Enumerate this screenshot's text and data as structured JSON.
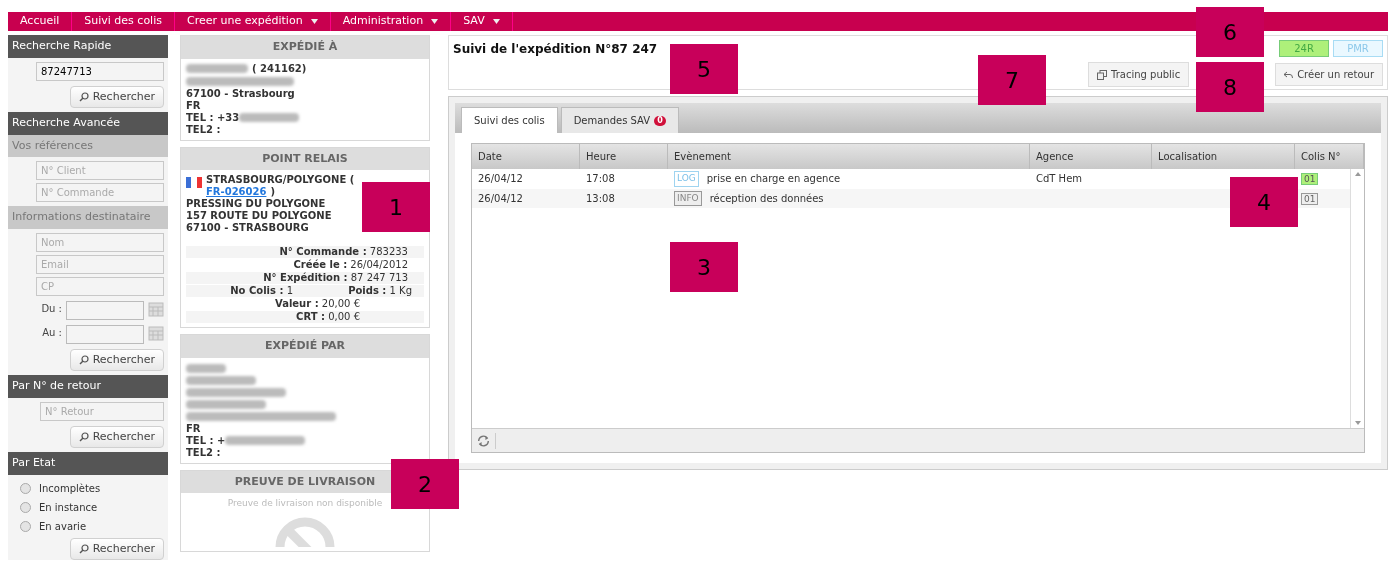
{
  "menu": [
    {
      "label": "Accueil",
      "dropdown": false
    },
    {
      "label": "Suivi des colis",
      "dropdown": false
    },
    {
      "label": "Creer une expédition",
      "dropdown": true
    },
    {
      "label": "Administration",
      "dropdown": true
    },
    {
      "label": "SAV",
      "dropdown": true
    }
  ],
  "sidebar": {
    "quick": {
      "title": "Recherche Rapide",
      "value": "87247713",
      "button": "Rechercher"
    },
    "advanced": {
      "title": "Recherche Avancée",
      "refs_title": "Vos références",
      "ref_fields": [
        {
          "placeholder": "N° Client"
        },
        {
          "placeholder": "N° Commande"
        }
      ],
      "dest_title": "Informations destinataire",
      "dest_fields": [
        {
          "placeholder": "Nom"
        },
        {
          "placeholder": "Email"
        },
        {
          "placeholder": "CP"
        }
      ],
      "from_label": "Du :",
      "to_label": "Au :",
      "button": "Rechercher"
    },
    "return": {
      "title": "Par N° de retour",
      "placeholder": "N° Retour",
      "button": "Rechercher"
    },
    "state": {
      "title": "Par Etat",
      "options": [
        {
          "label": "Incomplètes",
          "selected": false
        },
        {
          "label": "En instance",
          "selected": false
        },
        {
          "label": "En avarie",
          "selected": false
        }
      ],
      "button": "Rechercher"
    }
  },
  "recipient": {
    "title": "EXPÉDIÉ À",
    "code": "( 241162)",
    "city": "67100 - Strasbourg",
    "country": "FR",
    "tel": "TEL : +33",
    "tel2": "TEL2 :"
  },
  "relay": {
    "title": "POINT RELAIS",
    "name": "STRASBOURG/POLYGONE (",
    "link": "FR-026026",
    "close": ")",
    "lines": [
      "PRESSING DU POLYGONE",
      "157 ROUTE DU POLYGONE",
      "67100 - STRASBOURG"
    ],
    "details": [
      {
        "label": "N° Commande :",
        "value": "783233"
      },
      {
        "label": "Créée le :",
        "value": "26/04/2012"
      },
      {
        "label": "N° Expédition :",
        "value": "87 247 713"
      }
    ],
    "colis": {
      "label": "No Colis :",
      "value": "1"
    },
    "poids": {
      "label": "Poids :",
      "value": "1 Kg"
    },
    "details2": [
      {
        "label": "Valeur :",
        "value": "20,00 €"
      },
      {
        "label": "CRT :",
        "value": "0,00 €"
      }
    ]
  },
  "sender": {
    "title": "EXPÉDIÉ PAR",
    "country": "FR",
    "tel": "TEL : +",
    "tel2": "TEL2 :"
  },
  "proof": {
    "title": "PREUVE DE LIVRAISON",
    "message": "Preuve de livraison non disponible"
  },
  "header": {
    "title": "Suivi de l'expédition N°87 247",
    "badges": [
      {
        "label": "24R",
        "kind": "green"
      },
      {
        "label": "PMR",
        "kind": "blue"
      }
    ],
    "tracing": "Tracing public",
    "return": "Créer un retour"
  },
  "tabs": [
    {
      "label": "Suivi des colis",
      "selected": true
    },
    {
      "label": "Demandes SAV",
      "selected": false,
      "count": "0"
    }
  ],
  "table": {
    "columns": [
      "Date",
      "Heure",
      "Evènement",
      "Agence",
      "Localisation",
      "Colis N°"
    ],
    "rows": [
      {
        "date": "26/04/12",
        "time": "17:08",
        "tag": {
          "label": "LOG",
          "kind": "log"
        },
        "event": "prise en charge en agence",
        "agency": "CdT Hem",
        "colis": {
          "label": "01",
          "kind": "green"
        }
      },
      {
        "date": "26/04/12",
        "time": "13:08",
        "tag": {
          "label": "INFO",
          "kind": "info"
        },
        "event": "réception des données",
        "colis": {
          "label": "01",
          "kind": "gray"
        }
      }
    ]
  },
  "callouts": [
    {
      "label": "1"
    },
    {
      "label": "2"
    },
    {
      "label": "3"
    },
    {
      "label": "4"
    },
    {
      "label": "5"
    },
    {
      "label": "6"
    },
    {
      "label": "7"
    },
    {
      "label": "8"
    }
  ]
}
